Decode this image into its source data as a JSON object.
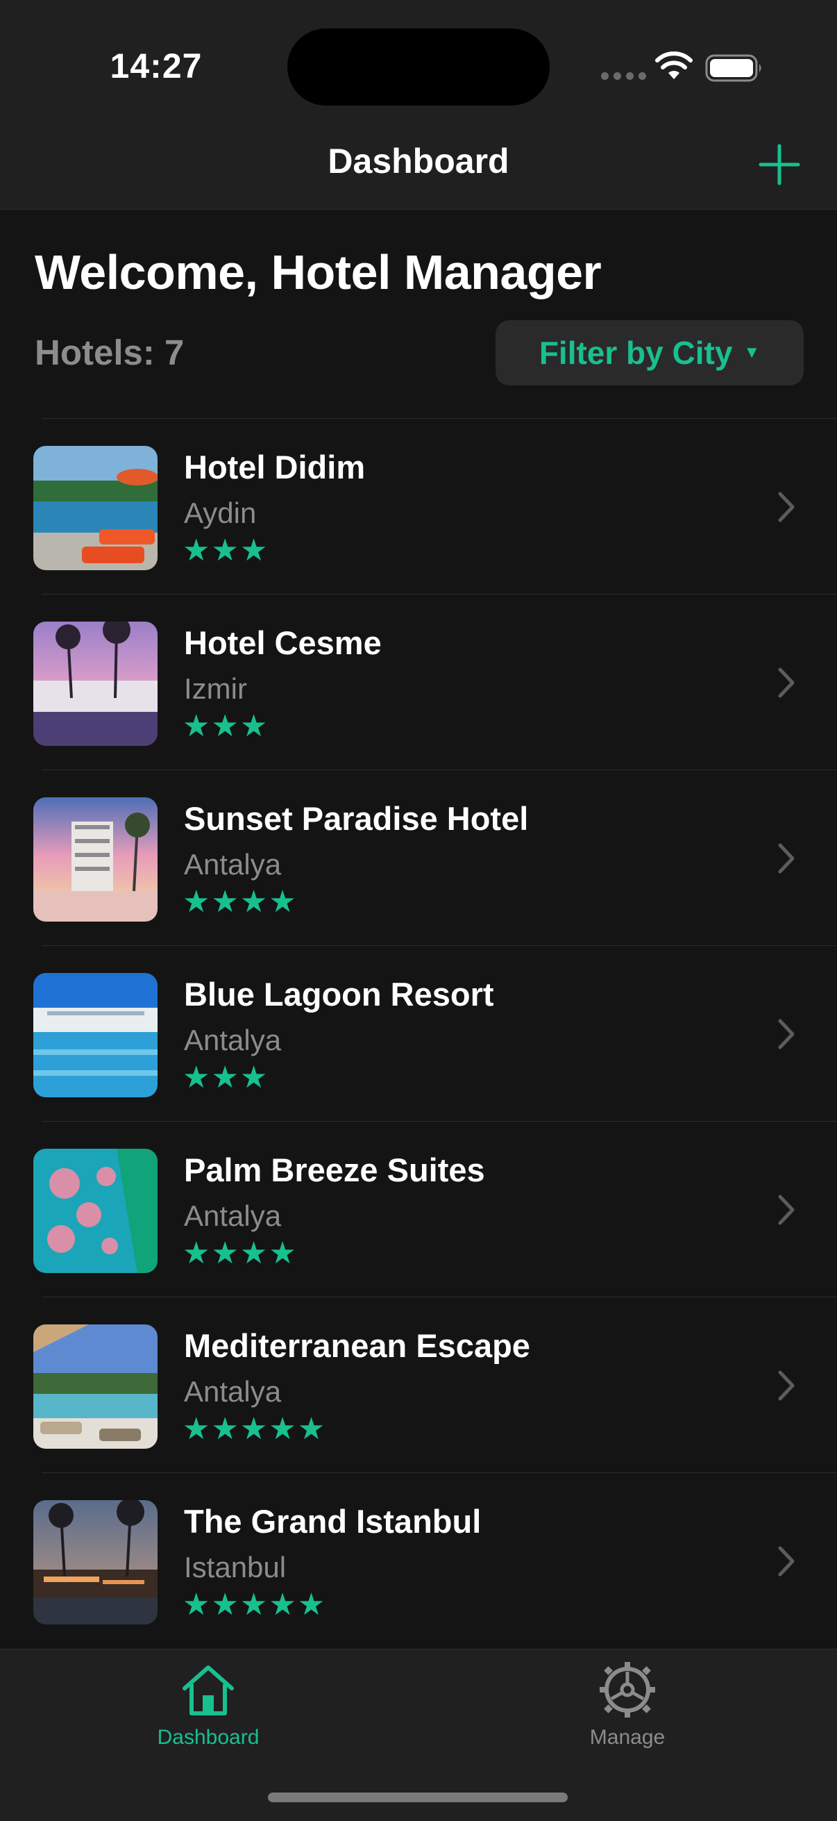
{
  "status_bar": {
    "time": "14:27"
  },
  "nav": {
    "title": "Dashboard",
    "add_icon": "plus-icon"
  },
  "header": {
    "welcome": "Welcome, Hotel Manager",
    "hotel_count": "Hotels: 7",
    "filter_label": "Filter by City",
    "filter_caret": "▼"
  },
  "hotels": [
    {
      "name": "Hotel Didim",
      "city": "Aydin",
      "stars": "★★★",
      "rating": 3
    },
    {
      "name": "Hotel Cesme",
      "city": "Izmir",
      "stars": "★★★",
      "rating": 3
    },
    {
      "name": "Sunset Paradise Hotel",
      "city": "Antalya",
      "stars": "★★★★",
      "rating": 4
    },
    {
      "name": "Blue Lagoon Resort",
      "city": "Antalya",
      "stars": "★★★",
      "rating": 3
    },
    {
      "name": "Palm Breeze Suites",
      "city": "Antalya",
      "stars": "★★★★",
      "rating": 4
    },
    {
      "name": "Mediterranean Escape",
      "city": "Antalya",
      "stars": "★★★★★",
      "rating": 5
    },
    {
      "name": "The Grand Istanbul",
      "city": "Istanbul",
      "stars": "★★★★★",
      "rating": 5
    }
  ],
  "tab_bar": {
    "tabs": [
      {
        "label": "Dashboard",
        "icon": "house-icon",
        "selected": true
      },
      {
        "label": "Manage",
        "icon": "gear-icon",
        "selected": false
      }
    ]
  },
  "colors": {
    "accent": "#18c08e",
    "background": "#141414",
    "bar": "#202020",
    "secondary_text": "#8c8c8c"
  }
}
